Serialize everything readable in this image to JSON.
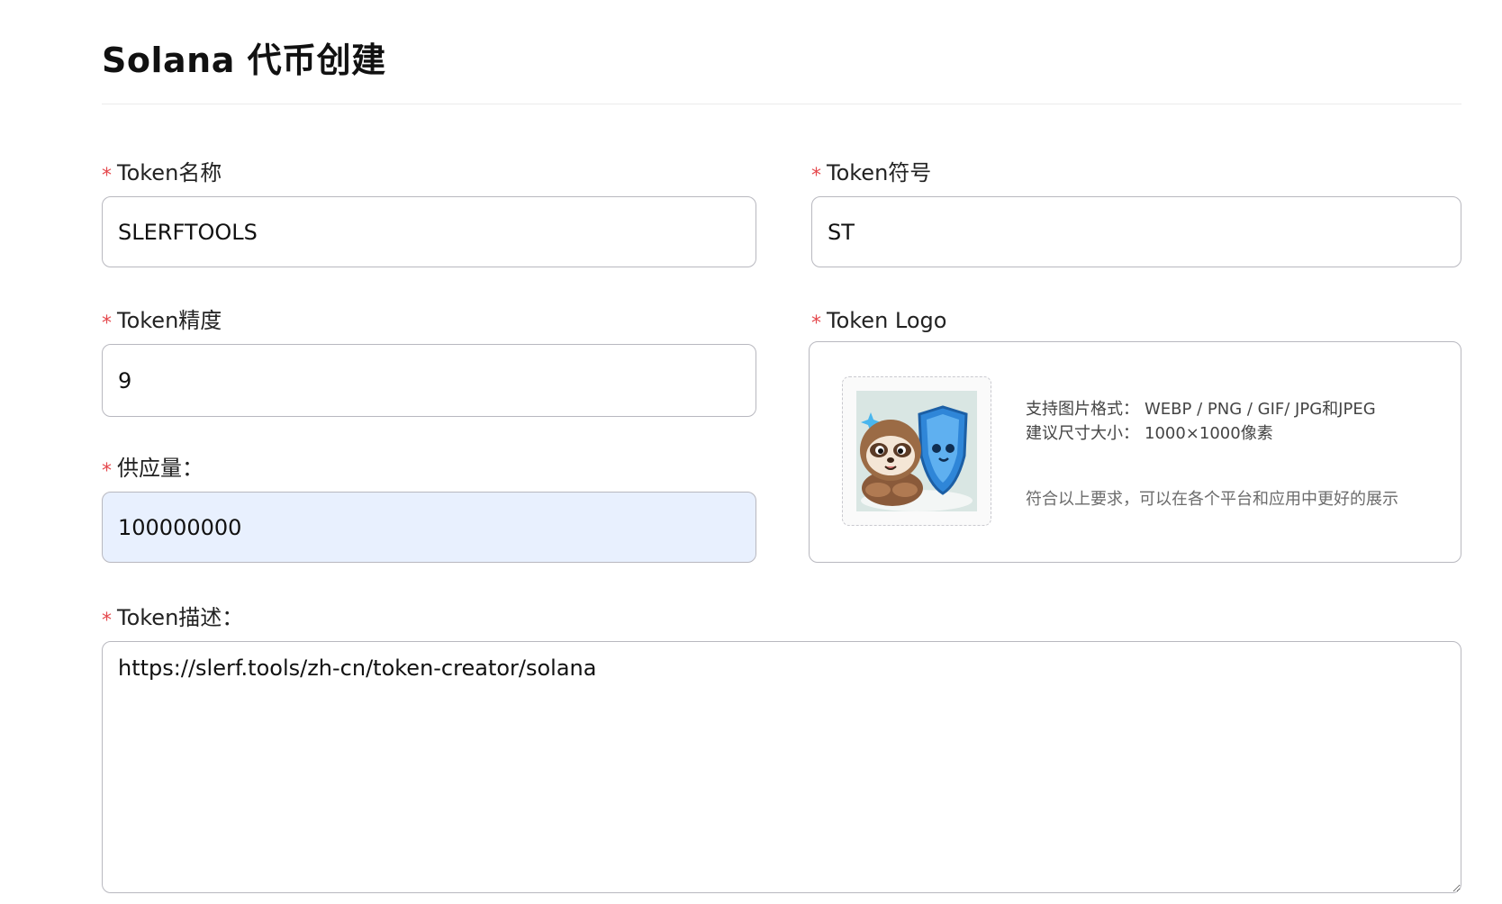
{
  "header": {
    "title": "Solana 代币创建"
  },
  "form": {
    "required_mark": "*",
    "token_name": {
      "label": "Token名称",
      "value": "SLERFTOOLS"
    },
    "token_symbol": {
      "label": "Token符号",
      "value": "ST"
    },
    "token_decimals": {
      "label": "Token精度",
      "value": "9"
    },
    "token_logo": {
      "label": "Token Logo",
      "formats_key": "支持图片格式：",
      "formats_value": "WEBP / PNG / GIF/ JPG和JPEG",
      "size_key": "建议尺寸大小：",
      "size_value": "1000×1000像素",
      "note": "符合以上要求，可以在各个平台和应用中更好的展示",
      "image_icon": "sloth-shield-logo-icon"
    },
    "supply": {
      "label": "供应量：",
      "value": "100000000"
    },
    "description": {
      "label": "Token描述：",
      "value": "https://slerf.tools/zh-cn/token-creator/solana"
    }
  },
  "colors": {
    "required": "#e5484d",
    "autofill_bg": "#e8f0fe",
    "border": "#b8b8bf"
  }
}
